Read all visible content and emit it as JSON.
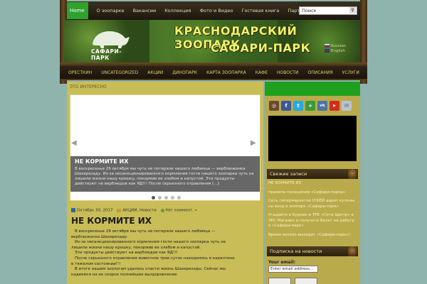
{
  "topnav": {
    "home": "Home",
    "items": [
      "О зоопарке",
      "Вакансии",
      "Коллекция",
      "Фото и Видео",
      "Гостевая книга",
      "Партнёры"
    ]
  },
  "search": {
    "placeholder": "Поиск"
  },
  "header": {
    "logo_text": "САФАРИ-ПАРК",
    "title_line1": "КРАСНОДАРСКИЙ ЗООПАРК",
    "title_line2": "САФАРИ-ПАРК",
    "lang_ru": "Russian",
    "lang_en": "English"
  },
  "mainnav": {
    "items": [
      "ОРЕСТКИН",
      "UNCATEGORIZED",
      "АКЦИИ",
      "ДИНОПАРК",
      "КАРТА ЗООПАРКА",
      "КАФЕ",
      "НОВОСТИ",
      "ОПИСАНИЯ",
      "УСЛУГИ"
    ]
  },
  "content": {
    "breadcrumb": "ЭТО ИНТЕРЕСНО",
    "slider": {
      "title": "НЕ КОРМИТЕ ИХ",
      "text": "В воскресенье 29 октября мы чуть не потеряли нашего любимца — верблюжонка Шахерезаду. Из-за несанкционированного кормления гости нашего зоопарка чуть не лишили жизни нашу крошку, покормив ее хлебом и капустой. Эти продукты действуют на верблюдов как ЯД!!! После серьезного отравления [...]"
    },
    "post": {
      "date": "Октябрь 30, 2017",
      "categories": "АКЦИИ, Новости",
      "comments": "Нет коммент. »",
      "title": "НЕ КОРМИТЕ ИХ",
      "p1": "В воскресенье 29 октября мы чуть не потеряли нашего любимца — верблюжонка Шахерезаду.",
      "p2": "Из-за несанкционированного кормления гости нашего зоопарка чуть не лишили жизни нашу крошку, покормив ее хлебом и капустой.",
      "p3": "Эти продукты действуют на верблюдов как ЯД!!!",
      "p4": "После серьезного отравления животное трое суток находилось в карантине в тяжелом состоянии!!!",
      "p5": "В итоге нашим зоологам удалось спасти жизнь Шахерезады. Сейчас мы надеемся на ее скорое полнейшее выздоровление."
    }
  },
  "sidebar": {
    "social": [
      "instagram",
      "facebook",
      "twitter",
      "google-plus",
      "vk",
      "youtube",
      "email"
    ],
    "recent_title": "Свежие записи",
    "recent": [
      "НЕ КОРМИТЕ ИХ",
      "правила посещения «Сафари-парка»",
      "Сеть гипермаркетов О'КЕЙ дарит купоны на вход в зоопарк «Сафари-парк»",
      "Угадайте в будние и ТРК «Сити Центр» в ЗЕС Магазин и получите билет на работу в «Сафари-парк»",
      "Время весело выходит «Сафари-парк»!"
    ],
    "subscribe_title": "Подписка на новости",
    "email_label": "Your email:",
    "email_placeholder": "Enter email address..."
  }
}
